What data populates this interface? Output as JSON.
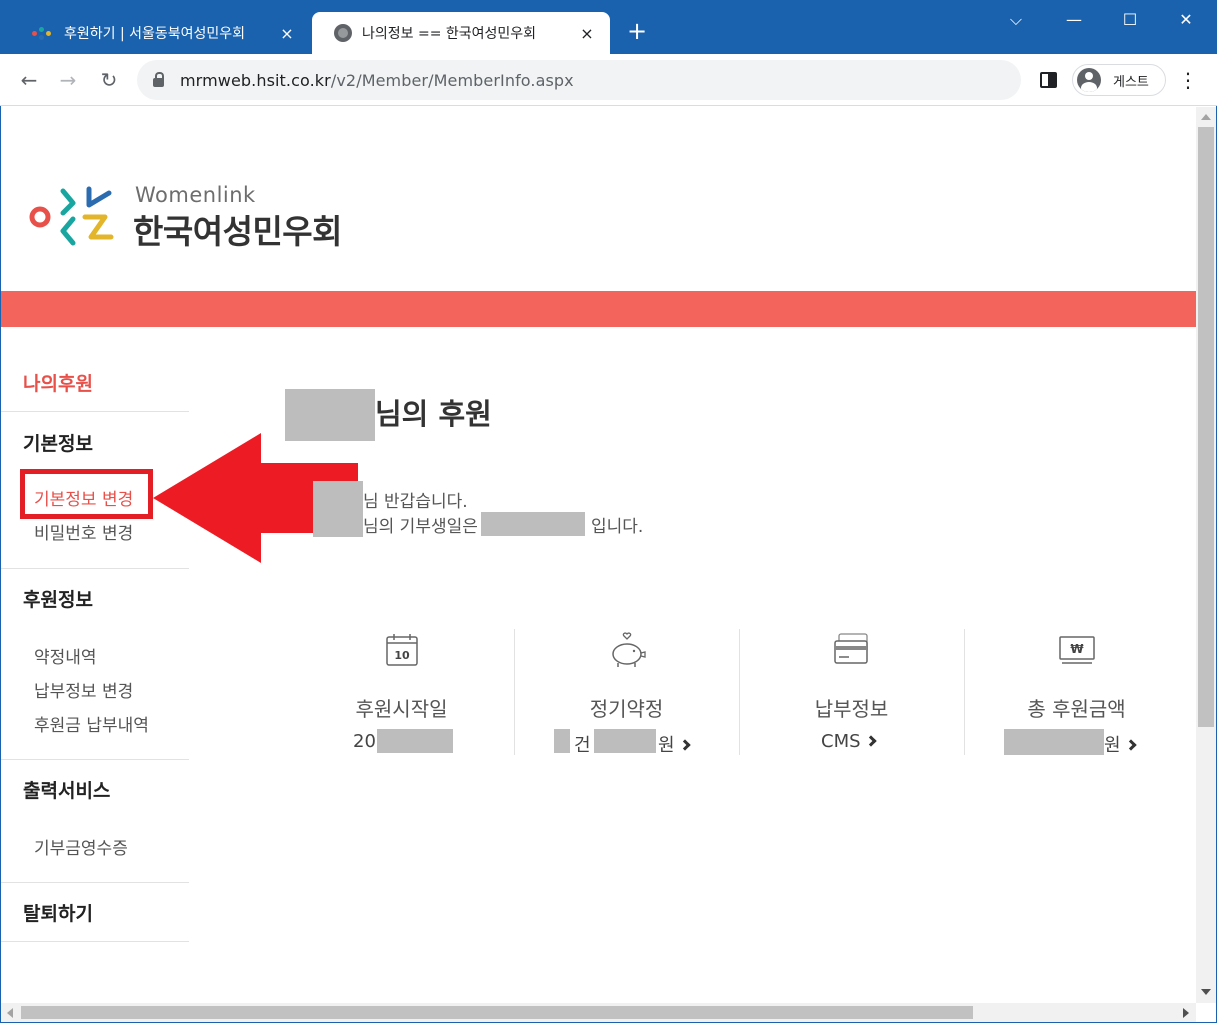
{
  "browser": {
    "tabs": [
      {
        "title": "후원하기 | 서울동북여성민우회",
        "active": false
      },
      {
        "title": "나의정보 == 한국여성민우회",
        "active": true
      }
    ],
    "url_domain": "mrmweb.hsit.co.kr",
    "url_path": "/v2/Member/MemberInfo.aspx",
    "profile_label": "게스트",
    "icons": {
      "back": "←",
      "forward": "→",
      "reload": "↻",
      "new_tab": "+",
      "close": "×",
      "minimize": "—",
      "maximize": "☐",
      "window_close": "✕",
      "chevron": "⌵",
      "menu": "⋮"
    }
  },
  "logo": {
    "en": "Womenlink",
    "ko": "한국여성민우회"
  },
  "sidebar": {
    "title": "나의후원",
    "sections": [
      {
        "heading": "기본정보",
        "items": [
          "기본정보 변경",
          "비밀번호 변경"
        ]
      },
      {
        "heading": "후원정보",
        "items": [
          "약정내역",
          "납부정보 변경",
          "후원금 납부내역"
        ]
      },
      {
        "heading": "출력서비스",
        "items": [
          "기부금영수증"
        ]
      },
      {
        "heading": "탈퇴하기",
        "items": []
      }
    ]
  },
  "greeting": {
    "title_suffix": "님의 후원",
    "line1": "님 반갑습니다.",
    "line2_prefix": "님의 기부생일은",
    "line2_suffix": "입니다."
  },
  "stats": [
    {
      "label": "후원시작일",
      "value_prefix": "20",
      "value_suffix": "",
      "icon_text": "10"
    },
    {
      "label": "정기약정",
      "value_prefix": "건",
      "value_suffix": "원"
    },
    {
      "label": "납부정보",
      "value_prefix": "CMS",
      "value_suffix": ""
    },
    {
      "label": "총 후원금액",
      "value_prefix": "",
      "value_suffix": "원",
      "icon_text": "₩"
    }
  ],
  "colors": {
    "tab_bar": "#1a62ae",
    "banner": "#f2645c",
    "accent_red": "#e8504a",
    "annotation_red": "#e31e24",
    "mask_gray": "#bdbdbd"
  }
}
